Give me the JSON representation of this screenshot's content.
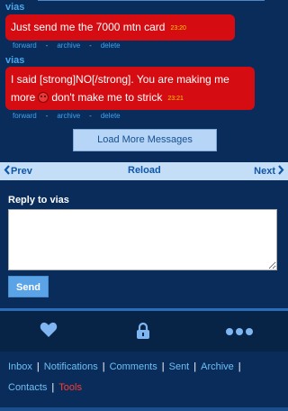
{
  "messages": [
    {
      "sender": "vias",
      "text": "Just send me the 7000 mtn card",
      "time": "23:20",
      "actions": [
        "forward",
        "archive",
        "delete"
      ]
    },
    {
      "sender": "vias",
      "text_part1": "I said [strong]NO[/strong]. You are making me",
      "text_part2a": "more",
      "emoji": "angry-face-icon",
      "text_part2b": "don't make me to strick",
      "time": "23:21",
      "actions": [
        "forward",
        "archive",
        "delete"
      ]
    }
  ],
  "load_more_label": "Load More Messages",
  "pager": {
    "prev": "Prev",
    "reload": "Reload",
    "next": "Next"
  },
  "reply": {
    "label": "Reply to vias",
    "value": "",
    "send_label": "Send"
  },
  "iconbar": [
    "heart-icon",
    "lock-icon",
    "more-dots-icon"
  ],
  "footer_links": {
    "inbox": "Inbox",
    "notifications": "Notifications",
    "comments": "Comments",
    "sent": "Sent",
    "archive": "Archive",
    "contacts": "Contacts",
    "tools": "Tools"
  },
  "colors": {
    "bg": "#0a2c5b",
    "bubble": "#d50d12",
    "time": "#f8d300",
    "link": "#6fbff2",
    "tools": "#ff3b2f"
  }
}
